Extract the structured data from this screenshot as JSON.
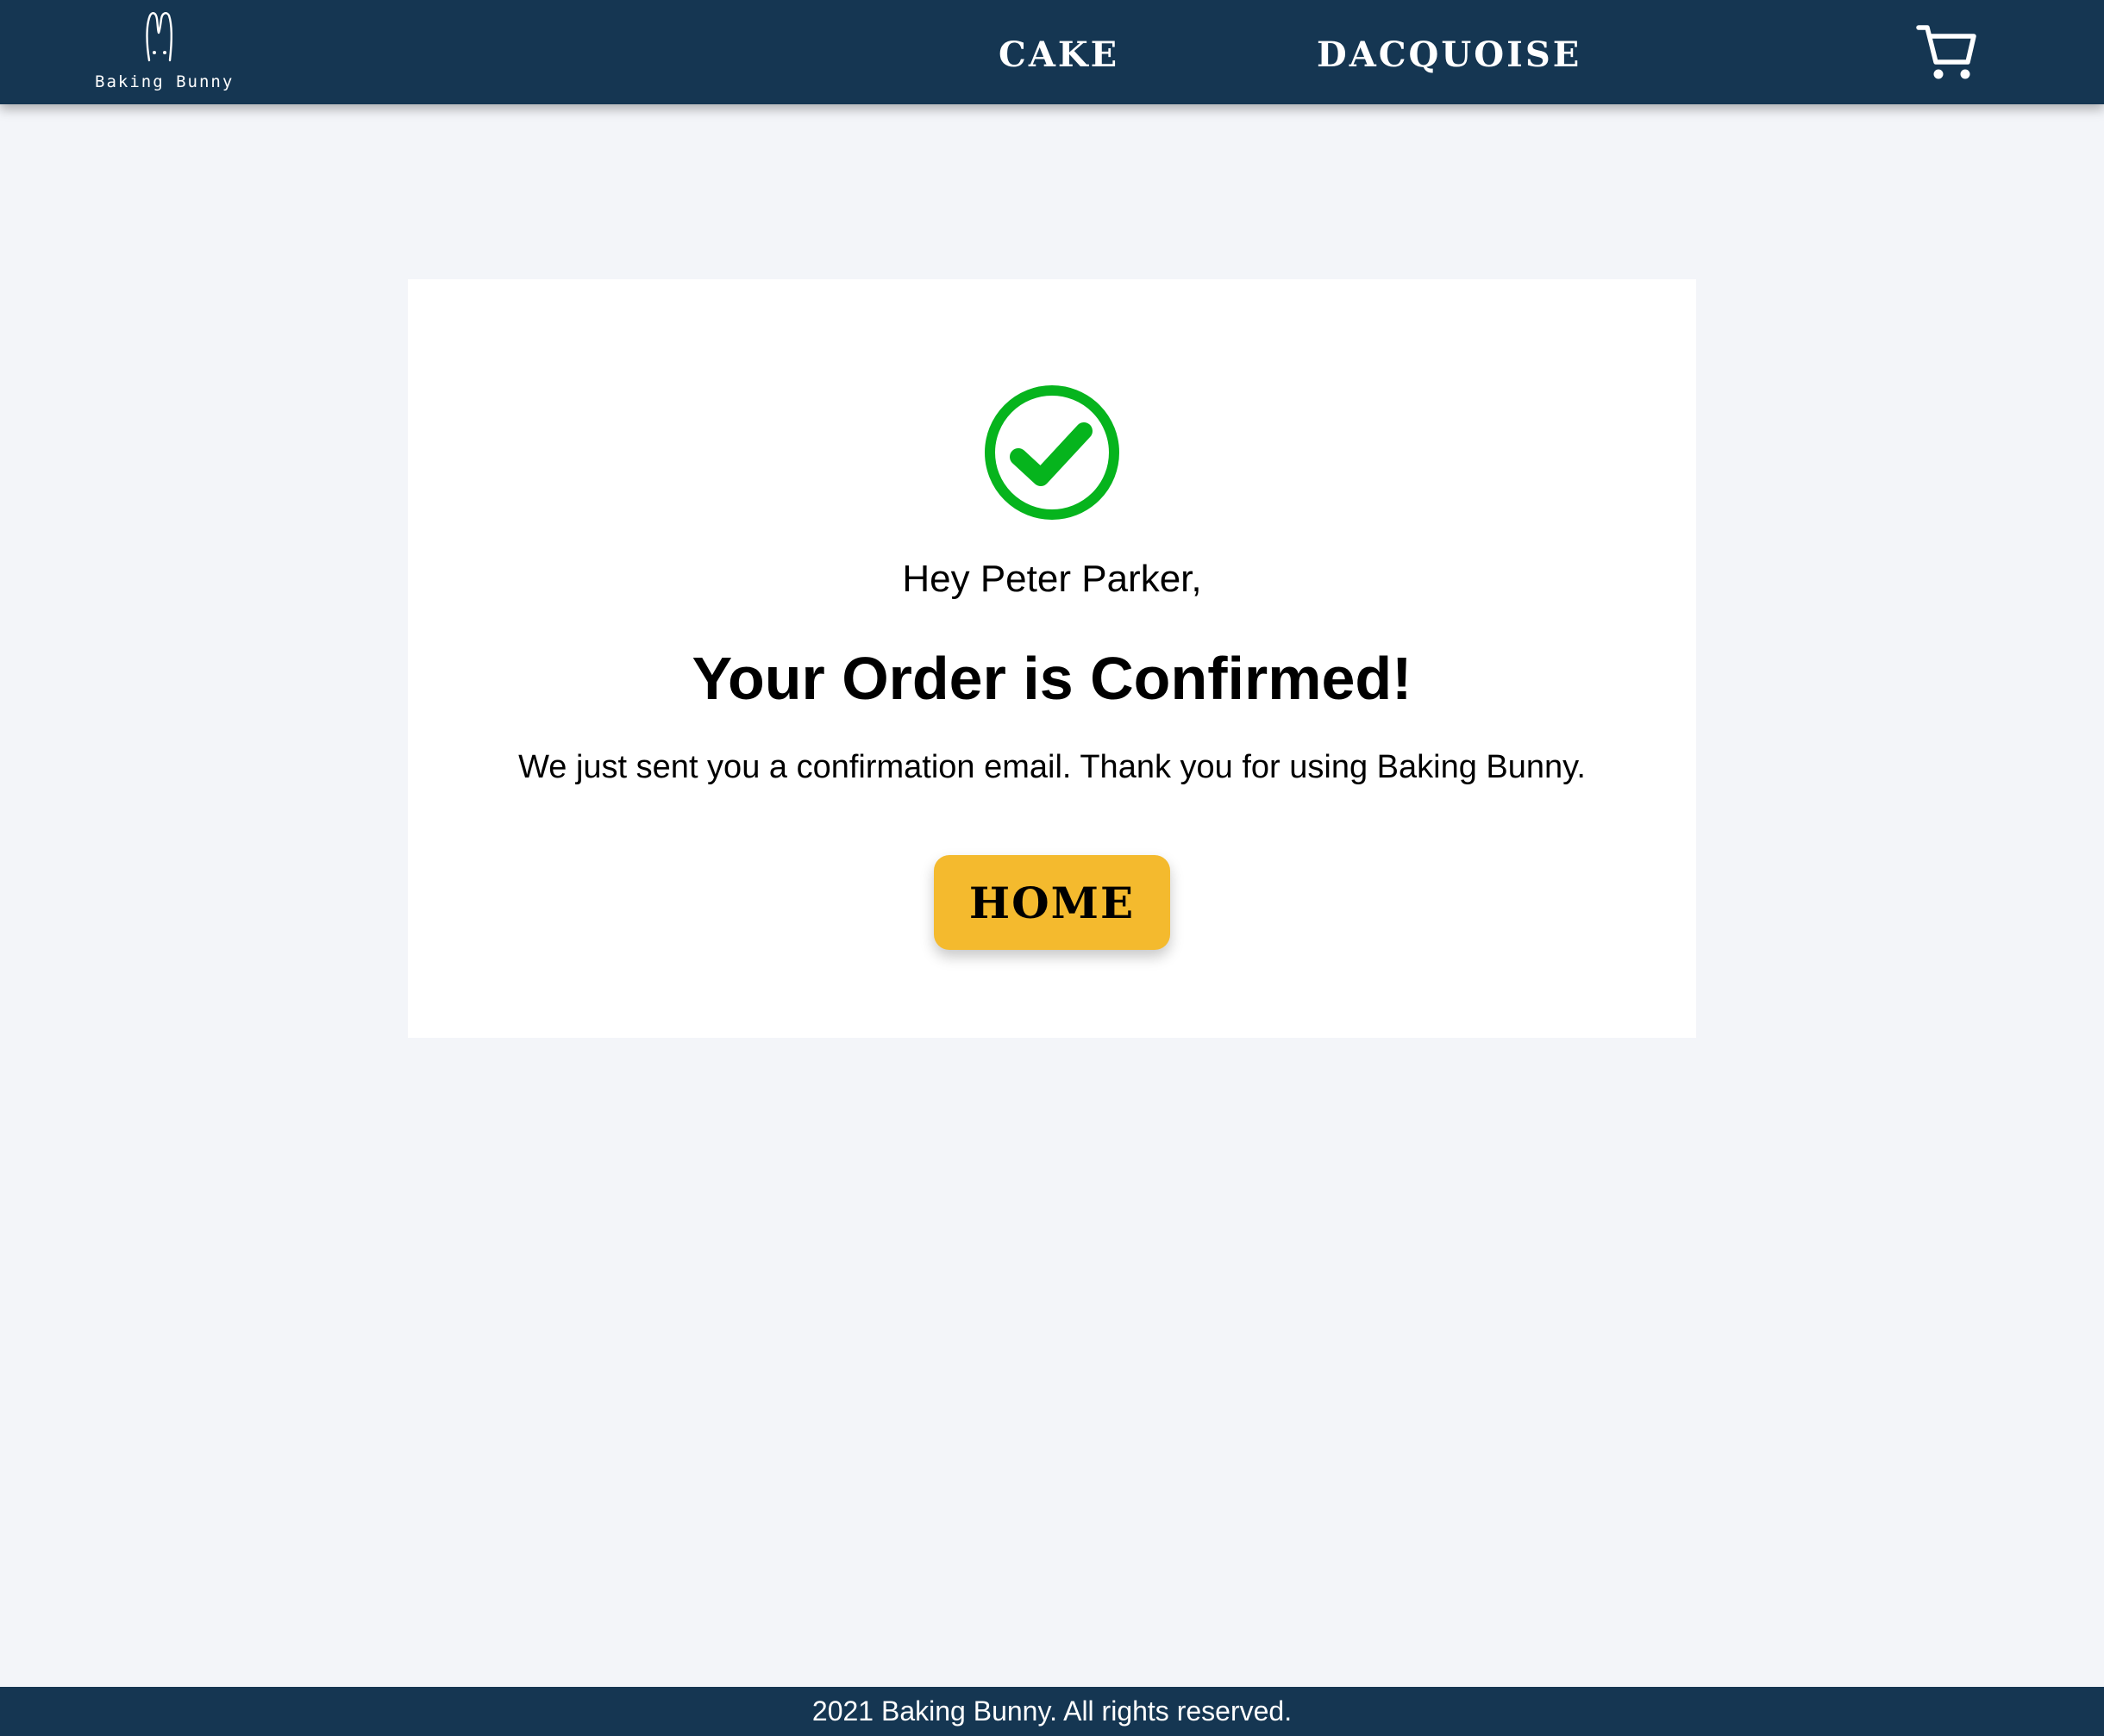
{
  "colors": {
    "nav_background": "#153652",
    "page_background": "#f3f5f9",
    "card_background": "#ffffff",
    "success_green": "#06b41d",
    "button_yellow": "#f4ba2e",
    "footer_background": "#153652"
  },
  "header": {
    "logo": {
      "icon": "bunny-logo-icon",
      "text": "Baking Bunny"
    },
    "nav": [
      {
        "label": "CAKE"
      },
      {
        "label": "DACQUOISE"
      }
    ],
    "cart": {
      "icon": "shopping-cart-icon"
    }
  },
  "confirmation": {
    "icon": "check-circle-icon",
    "greeting": "Hey Peter Parker,",
    "headline": "Your Order is Confirmed!",
    "message": "We just sent you a confirmation email. Thank you for using Baking Bunny.",
    "home_button_label": "HOME"
  },
  "footer": {
    "copyright": "2021 Baking Bunny. All rights reserved."
  }
}
